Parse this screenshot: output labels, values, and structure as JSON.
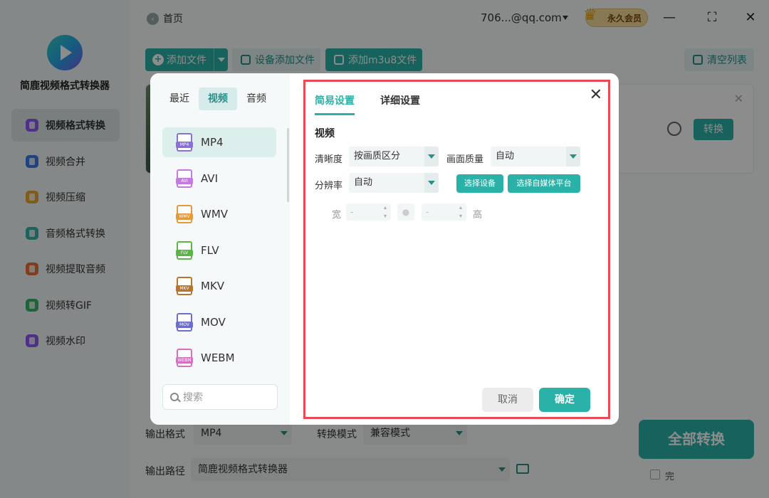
{
  "app": {
    "name": "简鹿视频格式转换器"
  },
  "sidebar": {
    "items": [
      {
        "label": "视频格式转换",
        "icon": "video-convert-icon",
        "color": "#8a5cf5"
      },
      {
        "label": "视频合并",
        "icon": "video-merge-icon",
        "color": "#3a7be8"
      },
      {
        "label": "视频压缩",
        "icon": "video-compress-icon",
        "color": "#e8a832"
      },
      {
        "label": "音频格式转换",
        "icon": "audio-convert-icon",
        "color": "#35b5a8"
      },
      {
        "label": "视频提取音频",
        "icon": "extract-audio-icon",
        "color": "#e8743a"
      },
      {
        "label": "视频转GIF",
        "icon": "video-gif-icon",
        "color": "#3ab56a"
      },
      {
        "label": "视频水印",
        "icon": "watermark-icon",
        "color": "#8a5cf5"
      }
    ]
  },
  "topbar": {
    "home_label": "首页",
    "account": "706...@qq.com",
    "vip_label": "永久会员",
    "vip_badge": "VIP"
  },
  "toolbar": {
    "add_file": "添加文件",
    "add_device": "设备添加文件",
    "add_m3u8": "添加m3u8文件",
    "clear_list": "清空列表"
  },
  "file_card": {
    "convert_label": "转换"
  },
  "bottom": {
    "output_format_label": "输出格式",
    "output_format_value": "MP4",
    "mode_label": "转换模式",
    "mode_value": "兼容模式",
    "path_label": "输出路径",
    "path_value": "简鹿视频格式转换器",
    "convert_all": "全部转换",
    "after_done": "完"
  },
  "dialog": {
    "category_tabs": [
      "最近",
      "视频",
      "音频"
    ],
    "formats": [
      {
        "name": "MP4",
        "color": "#8a6fd8"
      },
      {
        "name": "AVI",
        "color": "#c47adf"
      },
      {
        "name": "WMV",
        "color": "#e39a3c"
      },
      {
        "name": "FLV",
        "color": "#5ab546"
      },
      {
        "name": "MKV",
        "color": "#b8752f"
      },
      {
        "name": "MOV",
        "color": "#6c6fc9"
      },
      {
        "name": "WEBM",
        "color": "#d76fc4"
      }
    ],
    "search_placeholder": "搜索",
    "settings_tabs": [
      "简易设置",
      "详细设置"
    ],
    "section_title": "视频",
    "clarity_label": "清晰度",
    "clarity_value": "按画质区分",
    "quality_label": "画面质量",
    "quality_value": "自动",
    "resolution_label": "分辨率",
    "resolution_value": "自动",
    "select_device": "选择设备",
    "select_platform": "选择自媒体平台",
    "width_label": "宽",
    "height_label": "高",
    "width_value": "-",
    "height_value": "-",
    "cancel": "取消",
    "confirm": "确定"
  },
  "colors": {
    "accent": "#2bb2a8",
    "highlight_border": "#e84a55"
  }
}
